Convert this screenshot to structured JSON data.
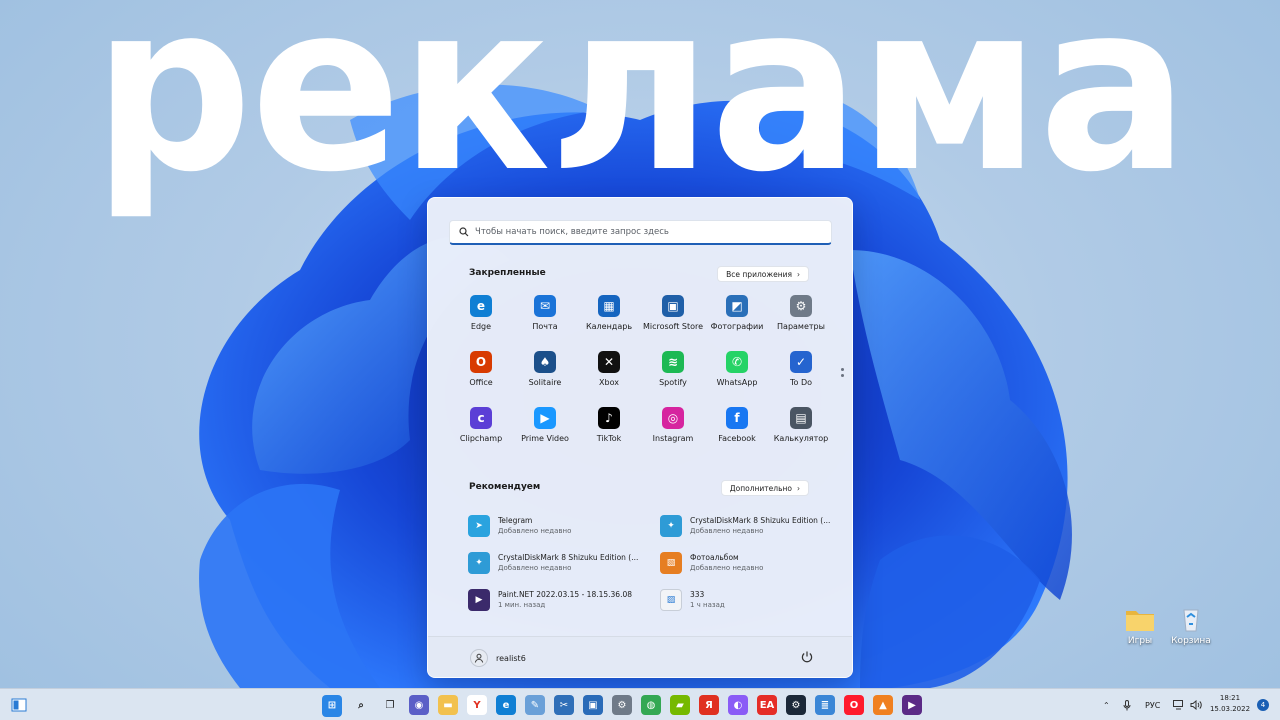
{
  "overlay": {
    "text": "реклама"
  },
  "desktop_icons": [
    {
      "label": "Игры",
      "icon": "folder-icon"
    },
    {
      "label": "Корзина",
      "icon": "recycle-bin-icon"
    }
  ],
  "start_menu": {
    "search_placeholder": "Чтобы начать поиск, введите запрос здесь",
    "pinned_title": "Закрепленные",
    "all_apps_label": "Все приложения",
    "pinned_apps": [
      {
        "label": "Edge",
        "icon": "edge-icon",
        "color": "#0f7fd4"
      },
      {
        "label": "Почта",
        "icon": "mail-icon",
        "color": "#1a73d8"
      },
      {
        "label": "Календарь",
        "icon": "calendar-icon",
        "color": "#1565c0"
      },
      {
        "label": "Microsoft Store",
        "icon": "store-icon",
        "color": "#1f5fa8"
      },
      {
        "label": "Фотографии",
        "icon": "photos-icon",
        "color": "#2a6fb8"
      },
      {
        "label": "Параметры",
        "icon": "settings-gear-icon",
        "color": "#6f7a88"
      },
      {
        "label": "Office",
        "icon": "office-icon",
        "color": "#d83b01"
      },
      {
        "label": "Solitaire",
        "icon": "solitaire-icon",
        "color": "#1b4f8a"
      },
      {
        "label": "Xbox",
        "icon": "xbox-icon",
        "color": "#111111"
      },
      {
        "label": "Spotify",
        "icon": "spotify-icon",
        "color": "#1db954"
      },
      {
        "label": "WhatsApp",
        "icon": "whatsapp-icon",
        "color": "#25d366"
      },
      {
        "label": "To Do",
        "icon": "todo-icon",
        "color": "#2564cf"
      },
      {
        "label": "Clipchamp",
        "icon": "clipchamp-icon",
        "color": "#5b3fd6"
      },
      {
        "label": "Prime Video",
        "icon": "prime-video-icon",
        "color": "#1a98ff"
      },
      {
        "label": "TikTok",
        "icon": "tiktok-icon",
        "color": "#010101"
      },
      {
        "label": "Instagram",
        "icon": "instagram-icon",
        "color": "#d6249f"
      },
      {
        "label": "Facebook",
        "icon": "facebook-icon",
        "color": "#1877f2"
      },
      {
        "label": "Калькулятор",
        "icon": "calculator-icon",
        "color": "#4a5563"
      }
    ],
    "recommended_title": "Рекомендуем",
    "more_label": "Дополнительно",
    "recommended": [
      {
        "title": "Telegram",
        "subtitle": "Добавлено недавно",
        "icon": "telegram-icon",
        "color": "#2aa3df"
      },
      {
        "title": "CrystalDiskMark 8 Shizuku Edition (...",
        "subtitle": "Добавлено недавно",
        "icon": "crystaldiskmark-icon",
        "color": "#2e9bd6"
      },
      {
        "title": "CrystalDiskMark 8 Shizuku Edition (...",
        "subtitle": "Добавлено недавно",
        "icon": "crystaldiskmark-icon",
        "color": "#2e9bd6"
      },
      {
        "title": "Фотоальбом",
        "subtitle": "Добавлено недавно",
        "icon": "photo-album-icon",
        "color": "#e67e22"
      },
      {
        "title": "Paint.NET 2022.03.15 - 18.15.36.08",
        "subtitle": "1 мин. назад",
        "icon": "mp4-file-icon",
        "color": "#3b2a6b"
      },
      {
        "title": "333",
        "subtitle": "1 ч назад",
        "icon": "image-file-icon",
        "color": "#f2f4f7"
      }
    ],
    "user_name": "realist6"
  },
  "taskbar": {
    "language": "РУС",
    "time": "18:21",
    "date": "15.03.2022",
    "notifications": "4"
  }
}
